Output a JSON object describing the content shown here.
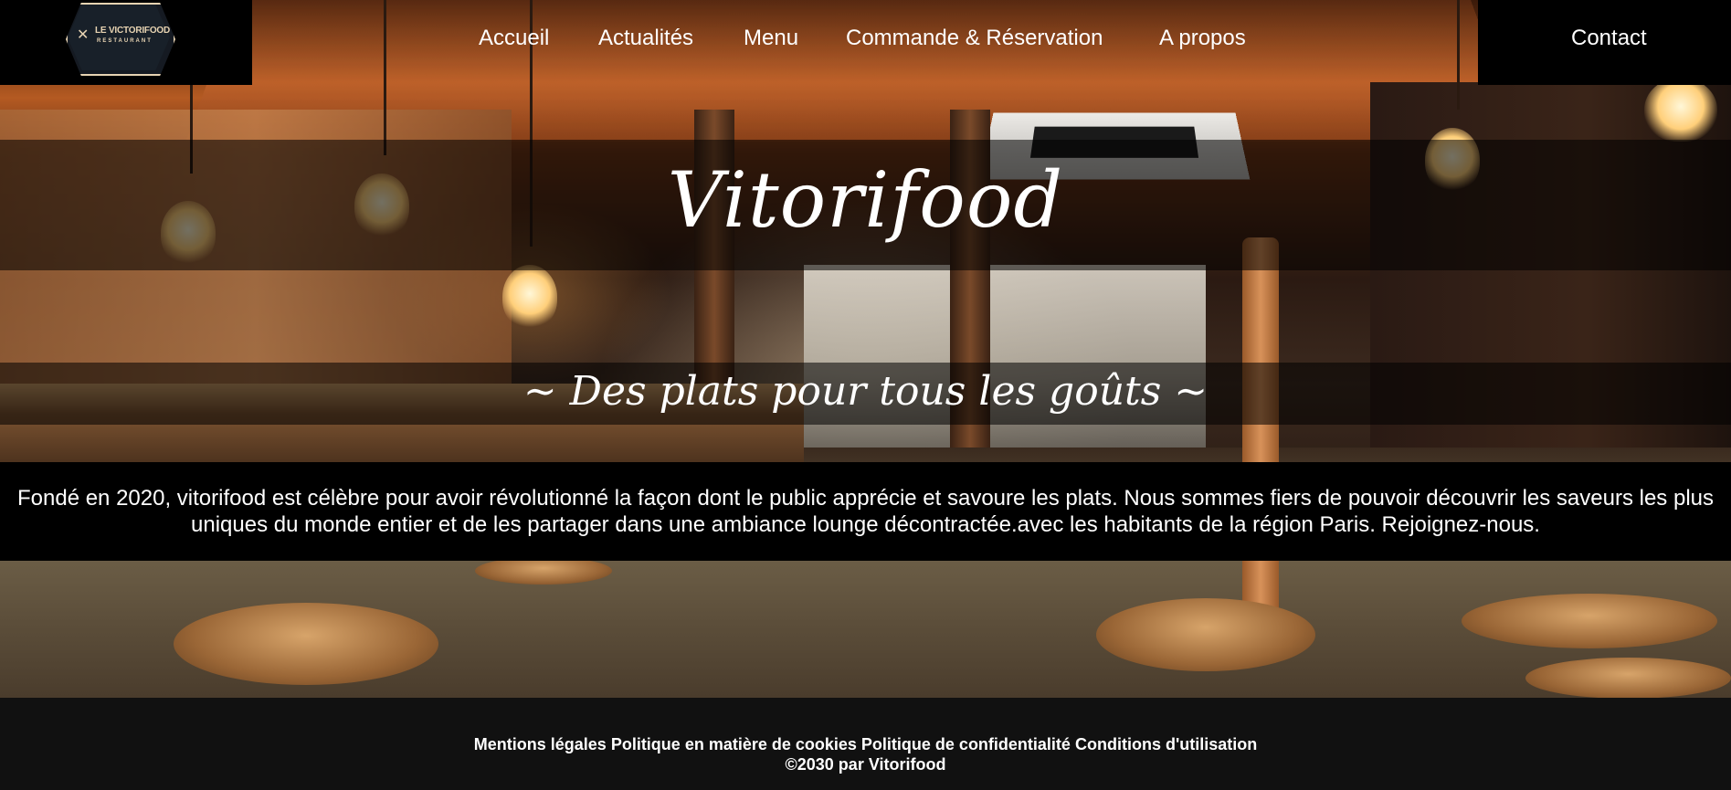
{
  "brand": {
    "logo_title": "LE VICTORIFOOD",
    "logo_subtitle": "RESTAURANT"
  },
  "nav": {
    "items": [
      {
        "label": "Accueil"
      },
      {
        "label": "Actualités"
      },
      {
        "label": "Menu"
      },
      {
        "label": "Commande & Réservation"
      },
      {
        "label": "A propos"
      }
    ],
    "contact_label": "Contact"
  },
  "hero": {
    "title": "Vitorifood",
    "subtitle": "~ Des plats pour tous les goûts ~"
  },
  "about": {
    "text": "Fondé en 2020, vitorifood est célèbre pour avoir révolutionné la façon dont le public apprécie et savoure les plats. Nous sommes fiers de pouvoir découvrir les saveurs les plus uniques du monde entier et de les partager dans une ambiance lounge décontractée.avec les habitants de la région Paris. Rejoignez-nous."
  },
  "footer": {
    "links": [
      {
        "label": "Mentions légales"
      },
      {
        "label": "Politique en matière de cookies"
      },
      {
        "label": "Politique de confidentialité"
      },
      {
        "label": "Conditions d'utilisation"
      }
    ],
    "copyright": "©2030 par Vitorifood"
  },
  "colors": {
    "nav_bg": "#000000",
    "logo_accent": "#e7d3b2",
    "footer_bg": "#111111",
    "text": "#ffffff"
  },
  "icons": {
    "logo": "fork-knife-icon"
  }
}
